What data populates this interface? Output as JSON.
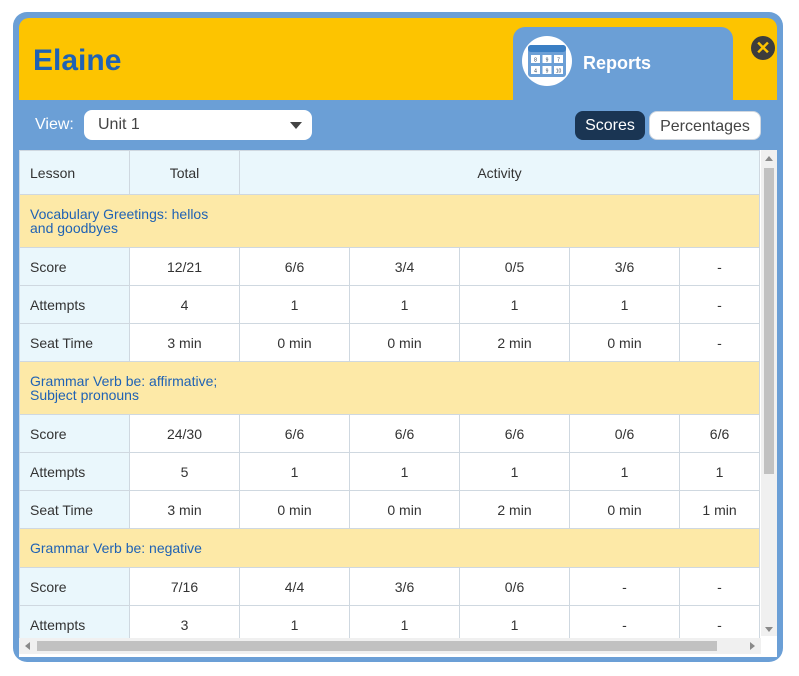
{
  "window": {
    "title": "Elaine",
    "close_icon": "close-icon",
    "accent": "#fdc400",
    "panel": "#6b9fd6"
  },
  "tab": {
    "label": "Reports",
    "icon": "calendar-grid-icon",
    "icon_numbers": [
      "8",
      "9",
      "7",
      "4",
      "9",
      "10"
    ]
  },
  "toolbar": {
    "view_label": "View:",
    "view_value": "Unit 1",
    "scores_label": "Scores",
    "percentages_label": "Percentages"
  },
  "table": {
    "headers": {
      "lesson": "Lesson",
      "total": "Total",
      "activity": "Activity"
    },
    "lessons": [
      {
        "title_line1": "Vocabulary Greetings: hellos",
        "title_line2": "and goodbyes",
        "rows": [
          {
            "label": "Score",
            "total": "12/21",
            "cells": [
              "6/6",
              "3/4",
              "0/5",
              "3/6",
              "-"
            ]
          },
          {
            "label": "Attempts",
            "total": "4",
            "cells": [
              "1",
              "1",
              "1",
              "1",
              "-"
            ]
          },
          {
            "label": "Seat Time",
            "total": "3 min",
            "cells": [
              "0 min",
              "0 min",
              "2 min",
              "0 min",
              "-"
            ]
          }
        ]
      },
      {
        "title_line1": "Grammar Verb be: affirmative;",
        "title_line2": "Subject pronouns",
        "rows": [
          {
            "label": "Score",
            "total": "24/30",
            "cells": [
              "6/6",
              "6/6",
              "6/6",
              "0/6",
              "6/6"
            ]
          },
          {
            "label": "Attempts",
            "total": "5",
            "cells": [
              "1",
              "1",
              "1",
              "1",
              "1"
            ]
          },
          {
            "label": "Seat Time",
            "total": "3 min",
            "cells": [
              "0 min",
              "0 min",
              "2 min",
              "0 min",
              "1 min"
            ]
          }
        ]
      },
      {
        "title_line1": "Grammar Verb be: negative",
        "title_line2": "",
        "rows": [
          {
            "label": "Score",
            "total": "7/16",
            "cells": [
              "4/4",
              "3/6",
              "0/6",
              "-",
              "-"
            ]
          },
          {
            "label": "Attempts",
            "total": "3",
            "cells": [
              "1",
              "1",
              "1",
              "-",
              "-"
            ]
          }
        ]
      }
    ]
  }
}
